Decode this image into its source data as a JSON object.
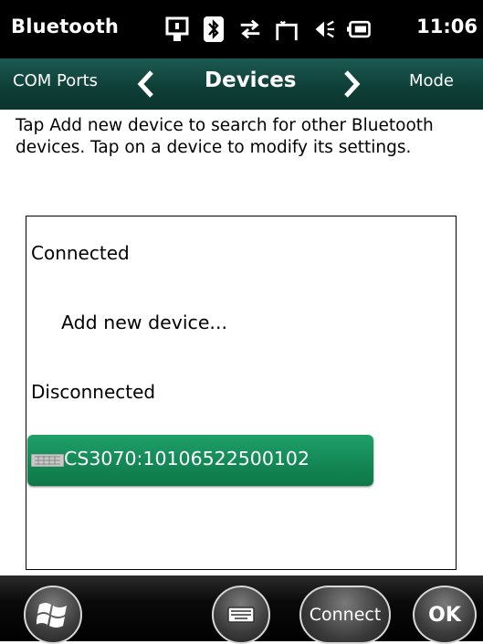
{
  "status_bar": {
    "app_title": "Bluetooth",
    "time": "11:06",
    "icons": [
      "sync-icon",
      "bluetooth-icon",
      "data-connection-icon",
      "signal-icon",
      "speaker-icon",
      "battery-charging-icon"
    ]
  },
  "tabs": {
    "previous": "COM Ports",
    "current": "Devices",
    "next": "Mode"
  },
  "instruction": "Tap Add new device to search for other Bluetooth devices. Tap on a device to modify its settings.",
  "device_list": {
    "connected_label": "Connected",
    "add_new_device": "Add new device...",
    "disconnected_label": "Disconnected",
    "devices": [
      {
        "name": "CS3070:10106522500102",
        "icon": "keyboard-icon",
        "selected": true
      }
    ]
  },
  "bottom_bar": {
    "connect_label": "Connect",
    "ok_label": "OK"
  },
  "colors": {
    "tab_bar": "#0f4038",
    "selected_item": "#148856",
    "status_bar": "#000000"
  }
}
